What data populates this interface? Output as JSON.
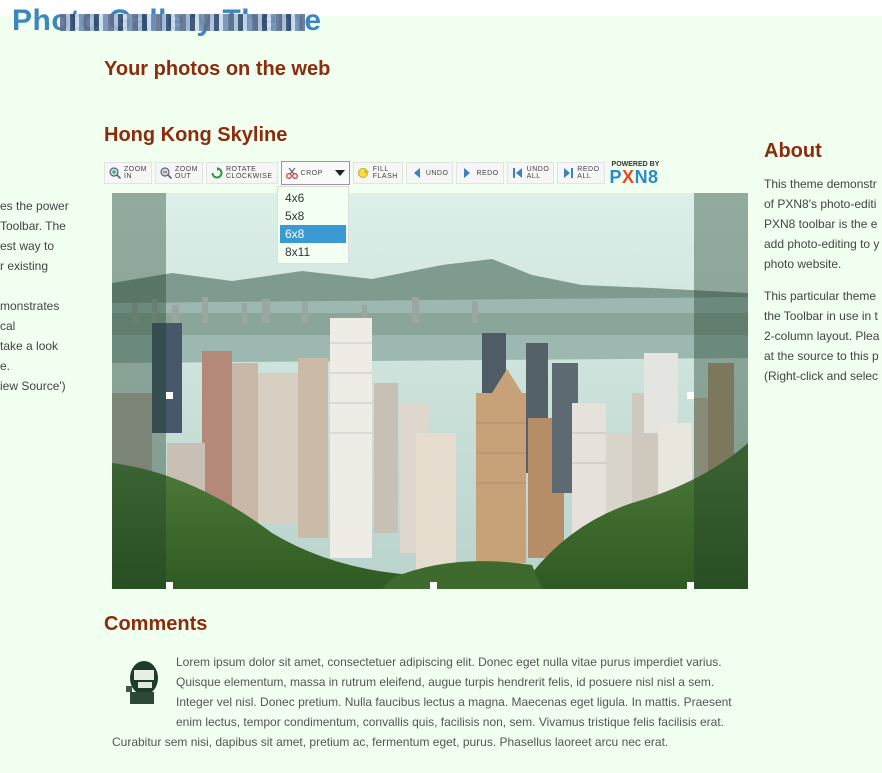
{
  "site": {
    "title": "Photo Gallery Theme",
    "tagline": "Your photos on the web"
  },
  "photo": {
    "title": "Hong Kong Skyline",
    "alt": "Hong Kong skyline seen from Victoria Peak"
  },
  "toolbar": {
    "zoom_in": "ZOOM\nIN",
    "zoom_out": "ZOOM\nOUT",
    "rotate": "ROTATE\nCLOCKWISE",
    "crop": "CROP",
    "fill_flash": "FILL\nFLASH",
    "undo": "UNDO",
    "redo": "REDO",
    "undo_all": "UNDO\nALL",
    "redo_all": "REDO\nALL",
    "powered_by": "POWERED BY",
    "brand": {
      "p": "P",
      "x": "X",
      "n8": "N8"
    }
  },
  "crop_options": {
    "opt0": "4x6",
    "opt1": "5x8",
    "opt2": "6x8",
    "opt3": "8x11",
    "selected": "6x8"
  },
  "left_sidebar": {
    "l0": "es the power",
    "l1": " Toolbar. The",
    "l2": "est way to",
    "l3": "r existing",
    "l4": "",
    "l5": "monstrates",
    "l6": "cal",
    "l7": " take a look",
    "l8": "e.",
    "l9": "iew Source')"
  },
  "about": {
    "heading": "About",
    "p1": {
      "l0": "This theme demonstr",
      "l1": "of PXN8's photo-editi",
      "l2": "PXN8 toolbar is the e",
      "l3": "add photo-editing to y",
      "l4": "photo website."
    },
    "p2": {
      "l0": "This particular theme",
      "l1": "the Toolbar in use in t",
      "l2": "2-column layout. Plea",
      "l3": "at the source to this p",
      "l4": "(Right-click and selec"
    }
  },
  "comments": {
    "heading": "Comments",
    "lines": {
      "l0": "Lorem ipsum dolor sit amet, consectetuer adipiscing elit. Donec eget nulla vitae purus imperdiet varius.",
      "l1": "Quisque elementum, massa in rutrum eleifend, augue turpis hendrerit felis, id posuere nisl nisl a sem.",
      "l2": "Integer vel nisl. Donec pretium. Nulla faucibus lectus a magna. Maecenas eget ligula. In mattis. Praesent",
      "l3": "enim lectus, tempor condimentum, convallis quis, facilisis non, sem. Vivamus tristique felis facilisis erat.",
      "l4": "Curabitur sem nisi, dapibus sit amet, pretium ac, fermentum eget, purus. Phasellus laoreet arcu nec erat."
    }
  },
  "colors": {
    "heading": "#8b2c0c",
    "title": "#3d87bf",
    "background": "#f0fff0",
    "selected": "#3a9ad3"
  }
}
